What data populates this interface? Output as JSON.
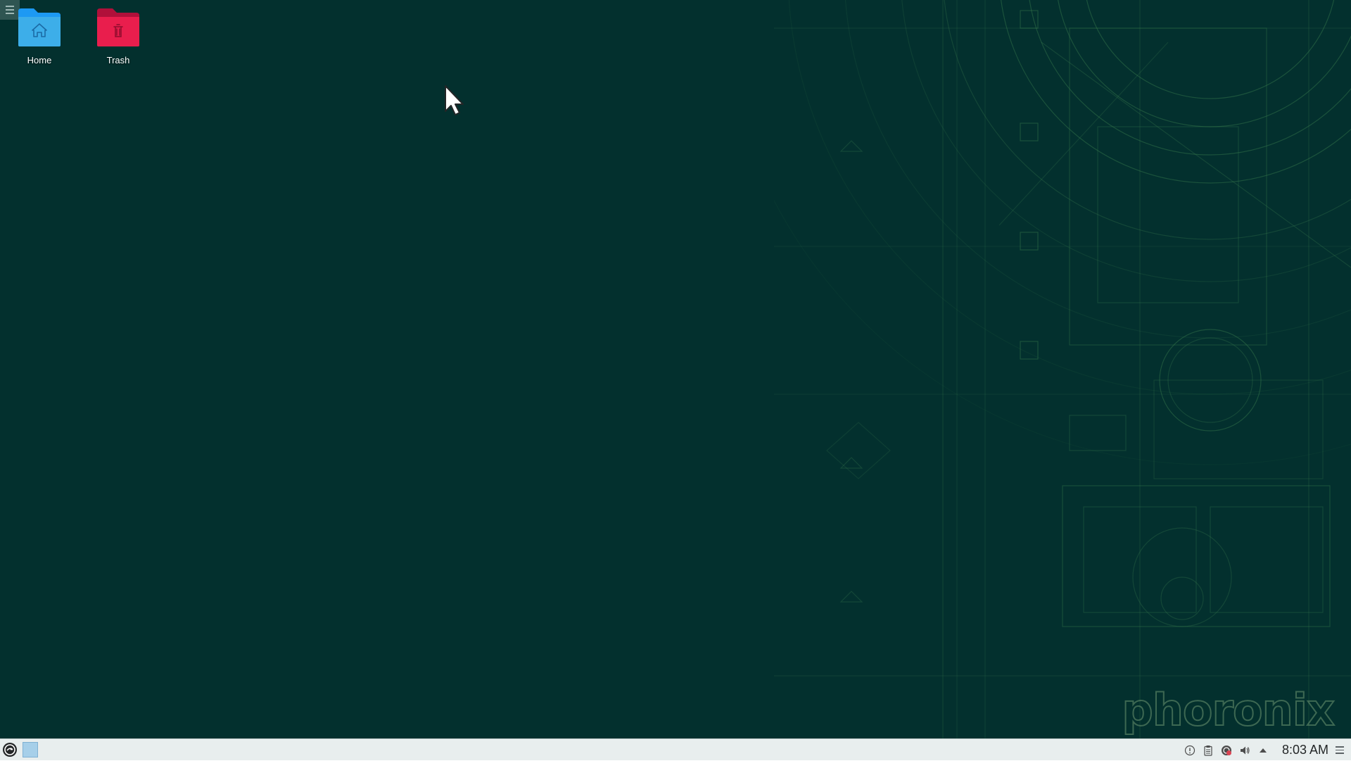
{
  "desktop": {
    "background_color": "#03302e",
    "icons": [
      {
        "label": "Home",
        "icon": "home-folder-icon",
        "color": "#3daee9"
      },
      {
        "label": "Trash",
        "icon": "trash-folder-icon",
        "color": "#e91e4d"
      }
    ],
    "watermark": "phoronix"
  },
  "taskbar": {
    "launcher_icon": "opensuse-launcher-icon",
    "pager_icon": "virtual-desktop-pager",
    "tray": {
      "icons": [
        "notifications-icon",
        "clipboard-icon",
        "updates-icon",
        "volume-icon",
        "expand-tray-icon"
      ],
      "clock": "8:03 AM"
    }
  }
}
